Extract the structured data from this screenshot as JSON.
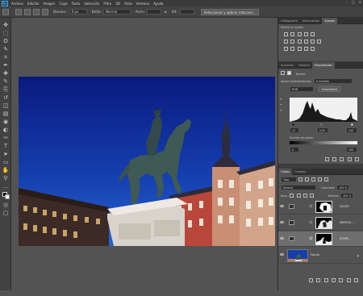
{
  "app": {
    "logo": "Ps"
  },
  "menu": [
    "Archivo",
    "Edición",
    "Imagen",
    "Capa",
    "Texto",
    "Selección",
    "Filtro",
    "3D",
    "Vista",
    "Ventana",
    "Ayuda"
  ],
  "window_controls": [
    "–",
    "□",
    "✕"
  ],
  "options": {
    "feather_label": "Desvan.:",
    "feather_value": "0 px",
    "style_label": "Estilo:",
    "style_value": "Normal",
    "width_label": "Anch.:",
    "height_label": "Alt.:",
    "select_mask_button": "Seleccionar y aplicar máscara..."
  },
  "tools": [
    "move-icon",
    "marquee-icon",
    "lasso-icon",
    "quick-select-icon",
    "crop-icon",
    "eyedropper-icon",
    "healing-icon",
    "brush-icon",
    "stamp-icon",
    "history-brush-icon",
    "eraser-icon",
    "gradient-icon",
    "blur-icon",
    "dodge-icon",
    "pen-icon",
    "type-icon",
    "path-select-icon",
    "shape-icon",
    "hand-icon",
    "zoom-icon",
    "more-icon",
    "color-swatches-icon",
    "quick-mask-icon",
    "screen-mode-icon"
  ],
  "tool_glyphs": [
    "✥",
    "⬚",
    "ʘ",
    "✎",
    "⌗",
    "✒",
    "✚",
    "✎",
    "⎘",
    "↺",
    "◫",
    "▤",
    "◉",
    "◐",
    "✑",
    "T",
    "➤",
    "▭",
    "✋",
    "⚲",
    "…",
    "◧",
    "◎",
    "▢"
  ],
  "panel1": {
    "tabs": [
      "Histograma",
      "Información",
      "Ajustes"
    ],
    "active_tab": 2,
    "title": "Añadir un ajuste"
  },
  "panel2": {
    "tabs": [
      "Acciones",
      "Historia",
      "Propiedades"
    ],
    "active_tab": 2,
    "adjust_title": "Niveles",
    "preset_label": "Ajuste preestablecido:",
    "preset_value": "A medida",
    "channel_value": "RGB",
    "auto_label": "Automático",
    "input_black": "12",
    "input_mid": "0,92",
    "input_white": "240",
    "output_label": "Niveles de salida:",
    "output_black": "0",
    "output_white": "255"
  },
  "layers_panel": {
    "tabs": [
      "Capas",
      "Canales"
    ],
    "active_tab": 0,
    "kind_label": "Tipo",
    "blend_mode": "Normal",
    "opacity_label": "Opacidad:",
    "opacity_value": "100 %",
    "lock_label": "Bloq.:",
    "fill_label": "Relleno:",
    "fill_value": "100 %",
    "layers": [
      {
        "name": "LUCES",
        "selected": false
      },
      {
        "name": "MEDIOS...",
        "selected": false
      },
      {
        "name": "SOMB...",
        "selected": true
      },
      {
        "name": "Fondo",
        "selected": false
      }
    ]
  },
  "colors": {
    "accent": "#31a8ff",
    "sky_top": "#0c1f8a",
    "sky_bottom": "#1f55c4",
    "building_red": "#b8463a"
  }
}
